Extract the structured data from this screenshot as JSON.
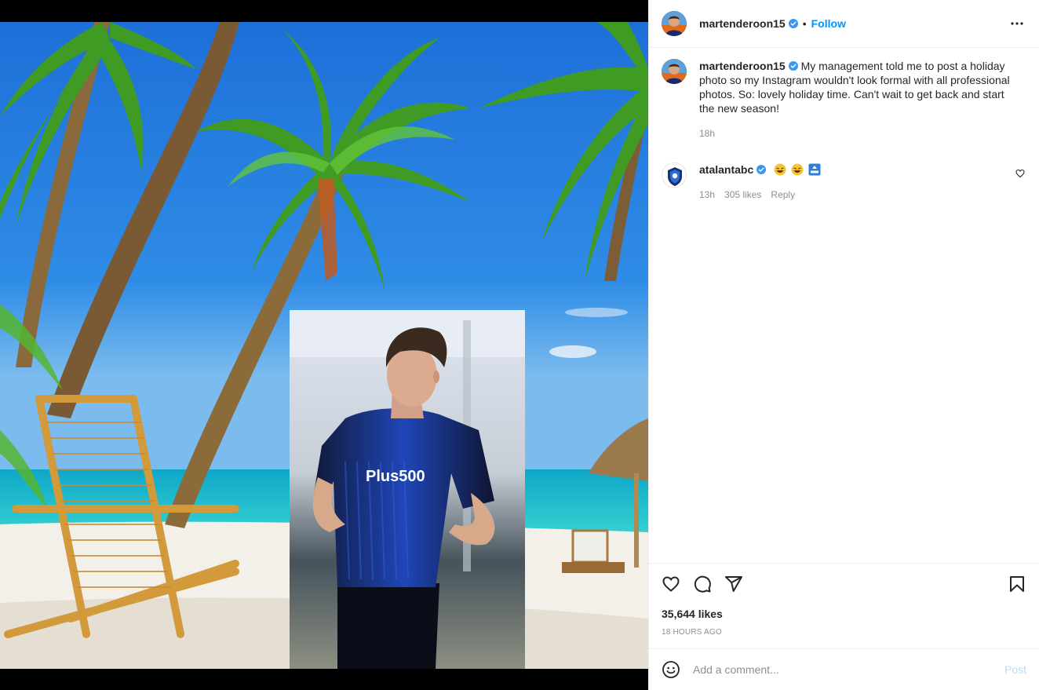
{
  "post": {
    "author": "martenderoon15",
    "follow_label": "Follow",
    "separator": "•",
    "more_icon": "more-horizontal-icon",
    "caption": "My management told me to post a holiday photo so my Instagram wouldn't look formal with all professional photos. So: lovely holiday time. Can't wait to get back and start the new season!",
    "caption_time": "18h",
    "likes": "35,644 likes",
    "time_ago": "18 hours ago"
  },
  "comments": [
    {
      "user": "atalantabc",
      "text": "",
      "emojis": [
        "laughing-emoji",
        "laughing-emoji",
        "top-emoji"
      ],
      "time": "13h",
      "likes": "305 likes",
      "reply_label": "Reply"
    }
  ],
  "actions": {
    "like_icon": "heart-icon",
    "comment_icon": "comment-icon",
    "share_icon": "paper-plane-icon",
    "save_icon": "bookmark-icon"
  },
  "composer": {
    "placeholder": "Add a comment...",
    "post_label": "Post",
    "emoji_icon": "smiley-icon"
  },
  "colors": {
    "accent": "#0095f6",
    "verified": "#3897f0",
    "post_disabled": "#b2dffc",
    "muted": "#8e8e8e"
  }
}
